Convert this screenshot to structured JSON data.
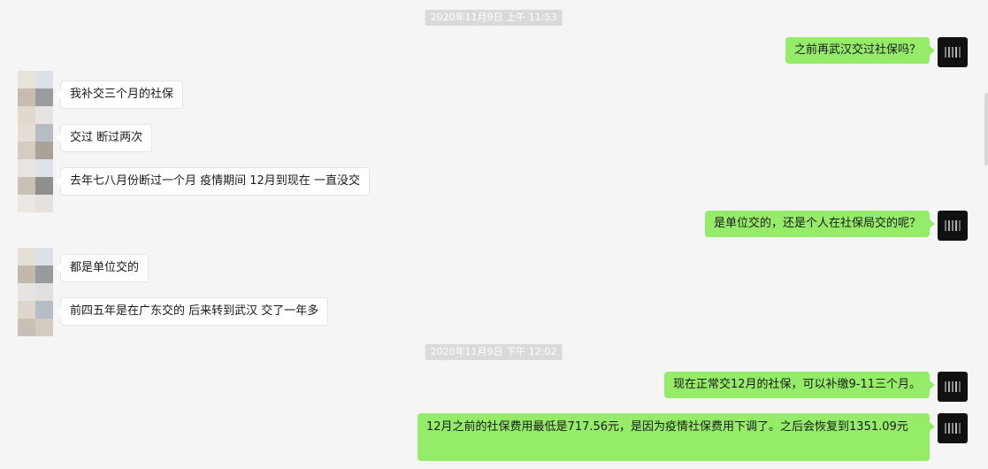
{
  "timestamps": [
    "2020年11月9日 上午 11:53",
    "2020年11月9日 下午 12:02"
  ],
  "messages": [
    {
      "dir": "out",
      "text": "之前再武汉交过社保吗？"
    },
    {
      "dir": "in",
      "text": "我补交三个月的社保"
    },
    {
      "dir": "in",
      "text": "交过 断过两次"
    },
    {
      "dir": "in",
      "text": "去年七八月份断过一个月 疫情期间 12月到现在 一直没交"
    },
    {
      "dir": "out",
      "text": "是单位交的，还是个人在社保局交的呢？"
    },
    {
      "dir": "in",
      "text": "都是单位交的"
    },
    {
      "dir": "in",
      "text": "前四五年是在广东交的 后来转到武汉 交了一年多"
    },
    {
      "dir": "out",
      "text": "现在正常交12月的社保，可以补缴9-11三个月。"
    },
    {
      "dir": "out",
      "text": "12月之前的社保费用最低是717.56元，是因为疫情社保费用下调了。之后会恢复到1351.09元"
    }
  ],
  "colors": {
    "background": "#f5f5f5",
    "outgoing_bubble": "#95ec69",
    "incoming_bubble": "#ffffff",
    "timestamp_bg": "#dadada"
  }
}
